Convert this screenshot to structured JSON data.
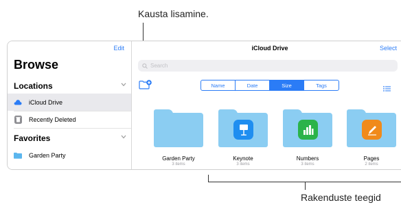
{
  "callouts": {
    "top": "Kausta lisamine.",
    "bottom": "Rakenduste teegid"
  },
  "sidebar": {
    "edit_label": "Edit",
    "title": "Browse",
    "sections": [
      {
        "label": "Locations",
        "items": [
          {
            "label": "iCloud Drive",
            "icon": "cloud-icon",
            "selected": true
          },
          {
            "label": "Recently Deleted",
            "icon": "trash-icon",
            "selected": false
          }
        ]
      },
      {
        "label": "Favorites",
        "items": [
          {
            "label": "Garden Party",
            "icon": "folder-icon",
            "selected": false
          }
        ]
      }
    ]
  },
  "main": {
    "title": "iCloud Drive",
    "select_label": "Select",
    "search_placeholder": "Search",
    "sort_options": [
      "Name",
      "Date",
      "Size",
      "Tags"
    ],
    "sort_active": "Size",
    "folders": [
      {
        "name": "Garden Party",
        "count": "3 items",
        "app_icon": null
      },
      {
        "name": "Keynote",
        "count": "3 items",
        "app_icon": "keynote-icon"
      },
      {
        "name": "Numbers",
        "count": "3 items",
        "app_icon": "numbers-icon"
      },
      {
        "name": "Pages",
        "count": "2 items",
        "app_icon": "pages-icon"
      }
    ]
  },
  "colors": {
    "accent": "#2b7cf6",
    "folder": "#8bcdf2",
    "keynote": "#1f8ef0",
    "numbers": "#2bb34a",
    "pages": "#f08a1a"
  }
}
